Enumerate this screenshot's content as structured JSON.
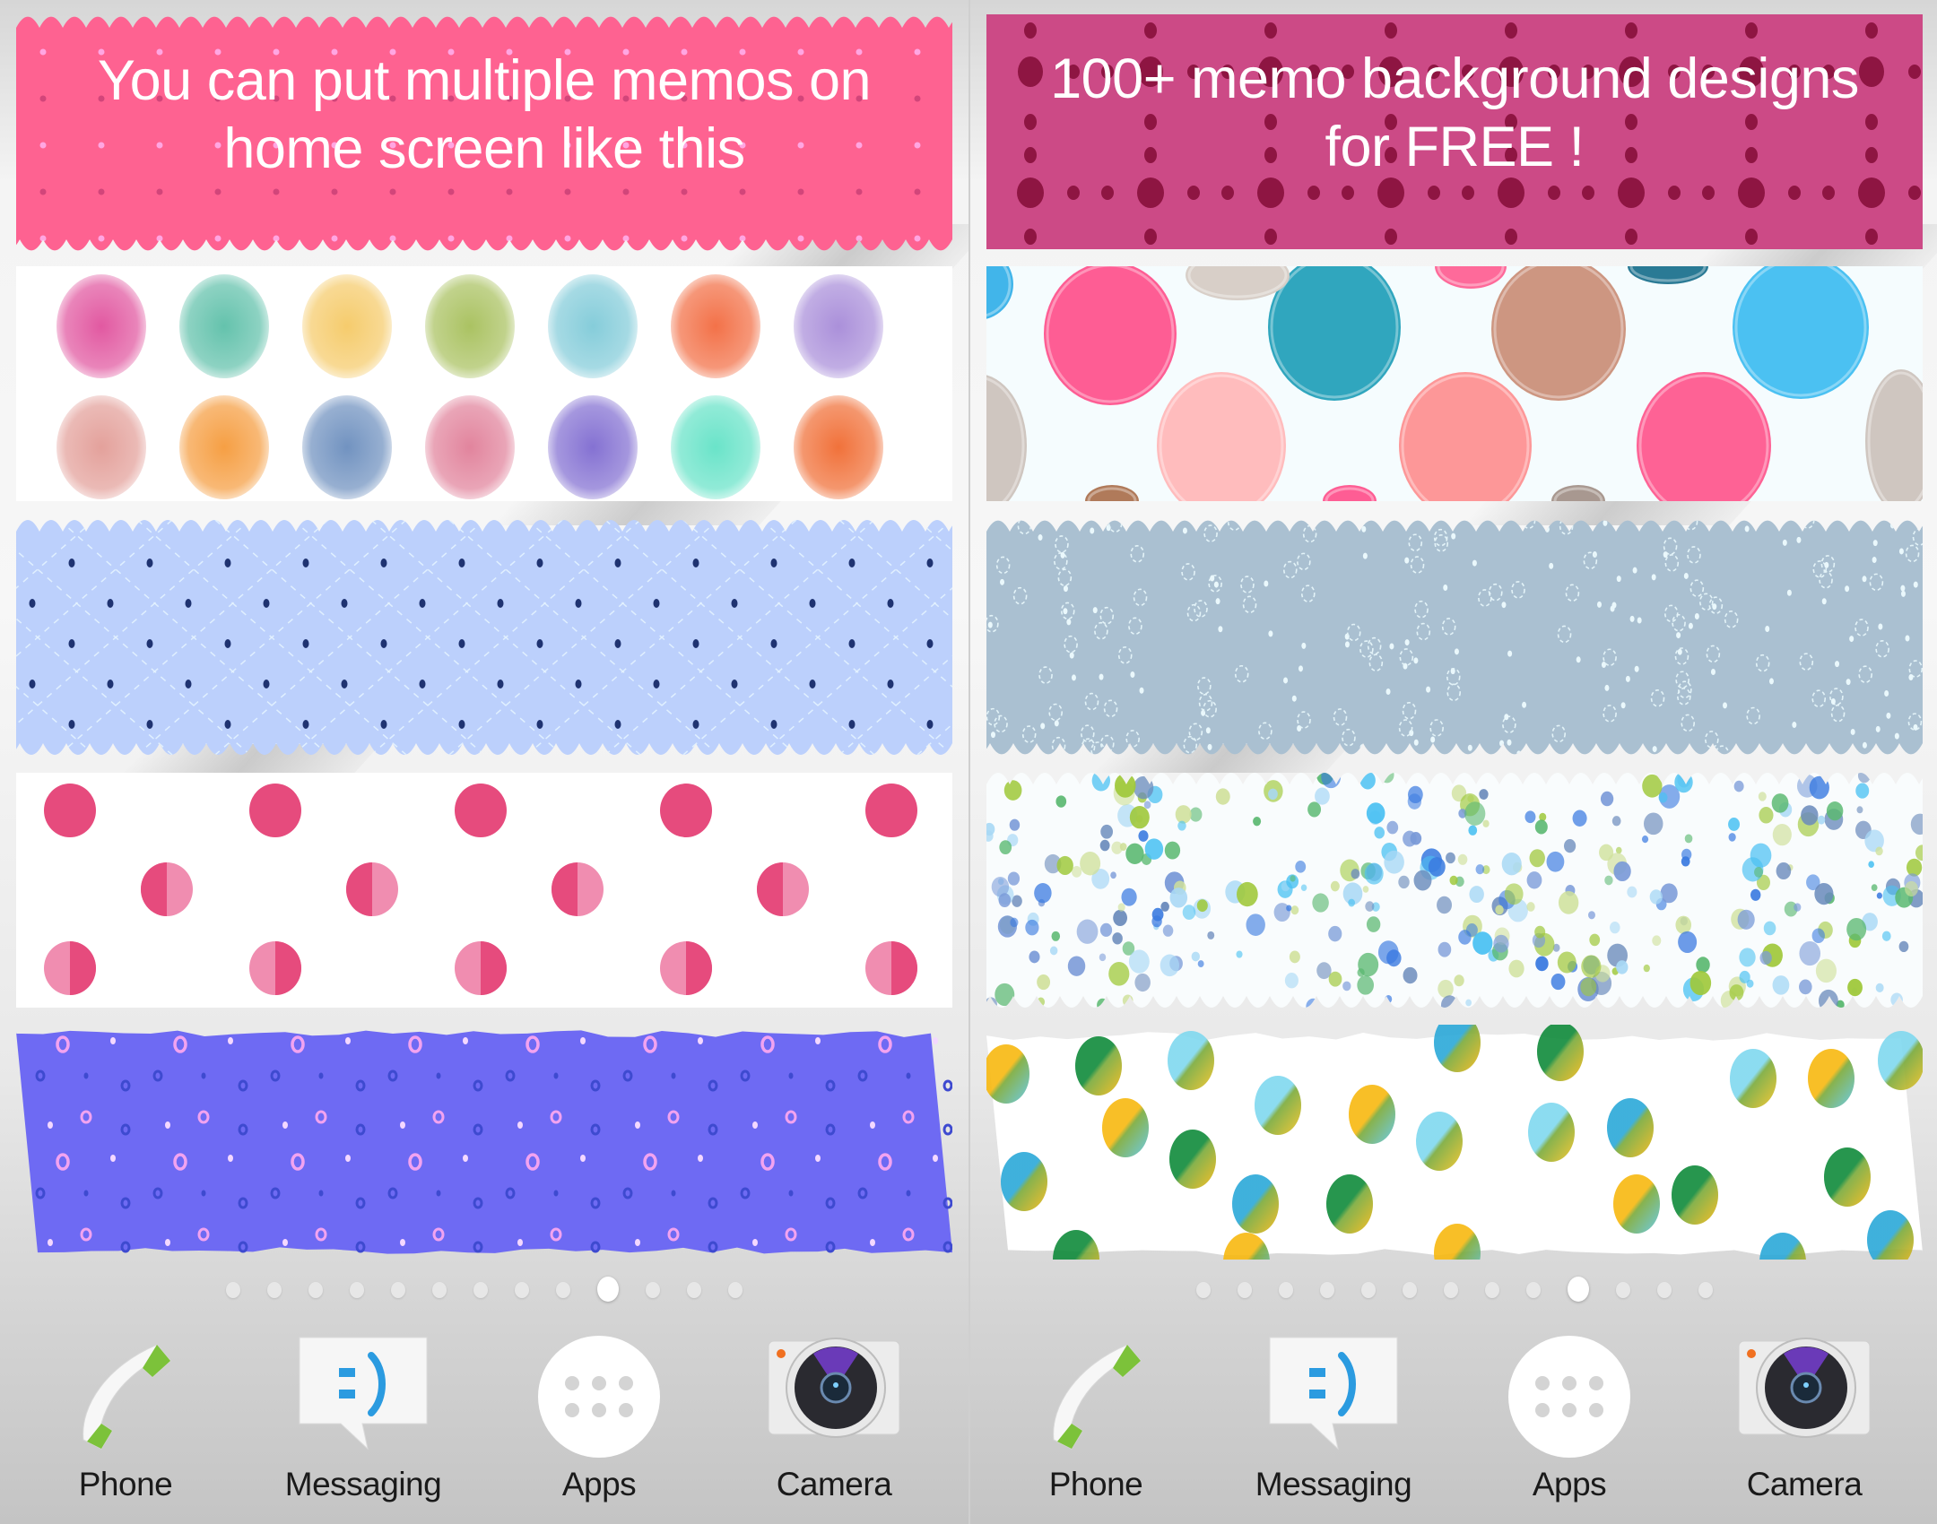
{
  "panels": [
    {
      "headline": [
        "You can put multiple memos on",
        "home screen like this"
      ],
      "memos": [
        {
          "name": "pink-scalloped-dot-memo",
          "bg": "#fe6291"
        },
        {
          "name": "watercolor-dots-memo",
          "bg": "#ffffff"
        },
        {
          "name": "blue-argyle-dot-memo",
          "bg": "#bcd0fc"
        },
        {
          "name": "pink-polka-dot-memo",
          "bg": "#ffffff"
        },
        {
          "name": "violet-ring-dot-memo",
          "bg": "#6e6af3"
        }
      ],
      "page_indicator": {
        "total": 13,
        "active_index": 9
      },
      "dock": [
        {
          "label": "Phone",
          "icon": "phone-icon"
        },
        {
          "label": "Messaging",
          "icon": "messaging-icon"
        },
        {
          "label": "Apps",
          "icon": "apps-icon"
        },
        {
          "label": "Camera",
          "icon": "camera-icon"
        }
      ]
    },
    {
      "headline": [
        "100+ memo background designs",
        "for FREE !"
      ],
      "memos": [
        {
          "name": "magenta-dot-memo",
          "bg": "#cc4a86"
        },
        {
          "name": "paint-circles-memo",
          "bg": "#f5fcfe"
        },
        {
          "name": "gray-blue-scalloped-memo",
          "bg": "#aac0d1"
        },
        {
          "name": "bubbles-memo",
          "bg": "#f9fcfd"
        },
        {
          "name": "yellow-blue-watercolor-memo",
          "bg": "#ffffff"
        }
      ],
      "page_indicator": {
        "total": 13,
        "active_index": 9
      },
      "dock": [
        {
          "label": "Phone",
          "icon": "phone-icon"
        },
        {
          "label": "Messaging",
          "icon": "messaging-icon"
        },
        {
          "label": "Apps",
          "icon": "apps-icon"
        },
        {
          "label": "Camera",
          "icon": "camera-icon"
        }
      ]
    }
  ],
  "colors": {
    "pink_memo": "#fe6291",
    "magenta_memo": "#cc4a86",
    "blue_memo": "#bcd0fc",
    "violet_memo": "#6e6af3",
    "grayblue_memo": "#aac0d1",
    "phone_green": "#7cc23a",
    "messaging_blue": "#2b9be0",
    "camera_orange": "#f07020"
  }
}
